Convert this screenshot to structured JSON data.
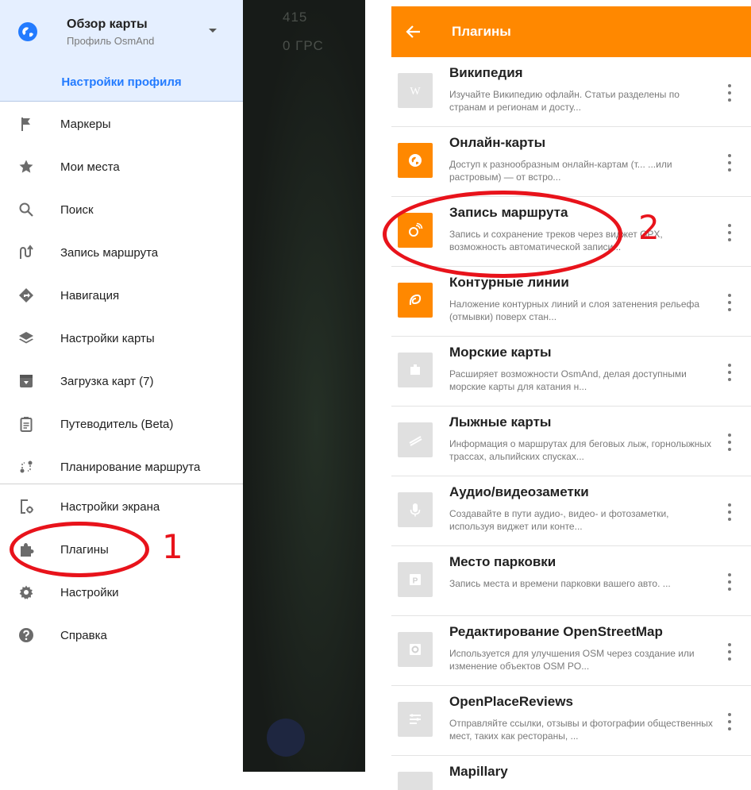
{
  "drawer": {
    "profile": {
      "title": "Обзор карты",
      "subtitle": "Профиль OsmAnd",
      "icon": "globe-icon"
    },
    "profile_settings_label": "Настройки профиля",
    "items": [
      {
        "label": "Маркеры",
        "icon": "flag-icon"
      },
      {
        "label": "Мои места",
        "icon": "star-icon"
      },
      {
        "label": "Поиск",
        "icon": "search-icon"
      },
      {
        "label": "Запись маршрута",
        "icon": "route-record-icon"
      },
      {
        "label": "Навигация",
        "icon": "navigation-icon"
      },
      {
        "label": "Настройки карты",
        "icon": "layers-icon"
      },
      {
        "label": "Загрузка карт (7)",
        "icon": "download-box-icon"
      },
      {
        "label": "Путеводитель (Beta)",
        "icon": "guide-icon"
      },
      {
        "label": "Планирование маршрута",
        "icon": "route-plan-icon"
      },
      {
        "label": "Настройки экрана",
        "icon": "screen-settings-icon"
      },
      {
        "label": "Плагины",
        "icon": "puzzle-icon"
      },
      {
        "label": "Настройки",
        "icon": "gear-icon"
      },
      {
        "label": "Справка",
        "icon": "help-icon"
      }
    ]
  },
  "map_overlay": {
    "text_1": "415",
    "text_2": "0 ГРС"
  },
  "plugins_screen": {
    "title": "Плагины",
    "plugins": [
      {
        "title": "Википедия",
        "desc": "Изучайте Википедию офлайн. Статьи разделены по странам и регионам и досту...",
        "enabled": false,
        "icon": "wikipedia-icon"
      },
      {
        "title": "Онлайн-карты",
        "desc": "Доступ к разнообразным онлайн-картам (т... ...или растровым) — от встро...",
        "enabled": true,
        "icon": "online-maps-icon"
      },
      {
        "title": "Запись маршрута",
        "desc": "Запись и сохранение треков через виджет GPX, возможность автоматической записи...",
        "enabled": true,
        "icon": "trip-recording-icon"
      },
      {
        "title": "Контурные линии",
        "desc": "Наложение контурных линий и слоя затенения рельефа (отмывки) поверх стан...",
        "enabled": true,
        "icon": "contour-lines-icon"
      },
      {
        "title": "Морские карты",
        "desc": "Расширяет возможности OsmAnd, делая доступными морские карты для катания н...",
        "enabled": false,
        "icon": "nautical-icon"
      },
      {
        "title": "Лыжные карты",
        "desc": "Информация о маршрутах для беговых лыж, горнолыжных трассах, альпийских спусках...",
        "enabled": false,
        "icon": "ski-icon"
      },
      {
        "title": "Аудио/видеозаметки",
        "desc": "Создавайте в пути аудио-, видео- и фотозаметки, используя виджет или конте...",
        "enabled": false,
        "icon": "microphone-icon"
      },
      {
        "title": "Место парковки",
        "desc": "Запись места и времени парковки вашего авто. ...",
        "enabled": false,
        "icon": "parking-icon"
      },
      {
        "title": "Редактирование OpenStreetMap",
        "desc": "Используется для улучшения OSM через создание или изменение объектов OSM PO...",
        "enabled": false,
        "icon": "osm-edit-icon"
      },
      {
        "title": "OpenPlaceReviews",
        "desc": "Отправляйте ссылки, отзывы и фотографии общественных мест, таких как рестораны, ...",
        "enabled": false,
        "icon": "reviews-icon"
      },
      {
        "title": "Mapillary",
        "desc": "",
        "enabled": false,
        "icon": "mapillary-icon"
      }
    ]
  },
  "annotations": {
    "num_1": "1",
    "num_2": "2"
  },
  "colors": {
    "accent": "#ff8800",
    "link": "#237bff",
    "annotation": "#e8131b",
    "header_bg": "#e5efff"
  }
}
